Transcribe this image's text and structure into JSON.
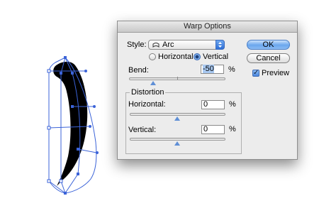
{
  "dialog": {
    "title": "Warp Options",
    "style": {
      "label": "Style:",
      "value": "Arc",
      "icon": "arc-icon"
    },
    "orientation": {
      "options": [
        "Horizontal",
        "Vertical"
      ],
      "selected": "Vertical"
    },
    "bend": {
      "label": "Bend:",
      "value": "-50",
      "unit": "%",
      "slider_value": -50
    },
    "distortion": {
      "group_label": "Distortion",
      "horizontal": {
        "label": "Horizontal:",
        "value": "0",
        "unit": "%",
        "slider_value": 0
      },
      "vertical": {
        "label": "Vertical:",
        "value": "0",
        "unit": "%",
        "slider_value": 0
      }
    },
    "buttons": {
      "ok": "OK",
      "cancel": "Cancel"
    },
    "preview": {
      "label": "Preview",
      "checked": true
    }
  },
  "colors": {
    "selection": "#3b63d8",
    "shape": "#000000",
    "default_button": "#6aa6ee"
  }
}
